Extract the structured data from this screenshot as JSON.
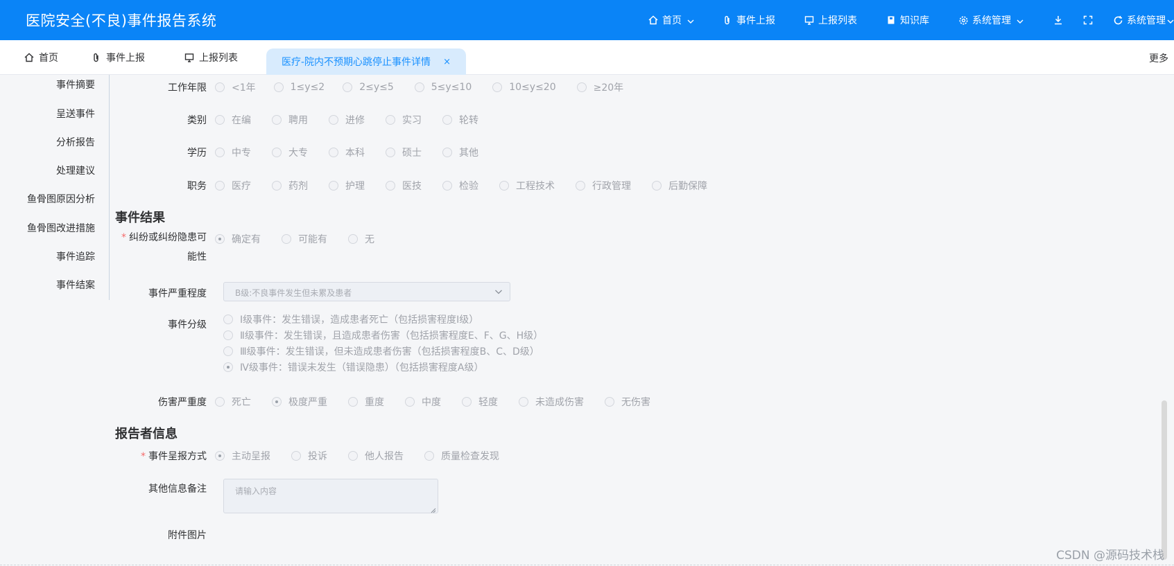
{
  "header": {
    "app_title": "医院安全(不良)事件报告系统",
    "nav": [
      {
        "label": "首页",
        "icon": "home-icon",
        "has_dropdown": true
      },
      {
        "label": "事件上报",
        "icon": "paperclip-icon",
        "has_dropdown": false
      },
      {
        "label": "上报列表",
        "icon": "monitor-icon",
        "has_dropdown": false
      },
      {
        "label": "知识库",
        "icon": "book-icon",
        "has_dropdown": false
      },
      {
        "label": "系统管理",
        "icon": "gear-icon",
        "has_dropdown": true
      },
      {
        "label": "",
        "icon": "download-icon",
        "has_dropdown": false
      },
      {
        "label": "",
        "icon": "fullscreen-icon",
        "has_dropdown": false
      },
      {
        "label": "系统管理",
        "icon": "refresh-icon",
        "has_dropdown": true
      }
    ]
  },
  "tabs": [
    {
      "label": "首页",
      "icon": "home-icon"
    },
    {
      "label": "事件上报",
      "icon": "paperclip-icon"
    },
    {
      "label": "上报列表",
      "icon": "monitor-icon"
    }
  ],
  "active_tab": {
    "label": "医疗-院内不预期心跳停止事件详情",
    "close": "×"
  },
  "more_label": "更多",
  "leftnav": [
    "事件摘要",
    "呈送事件",
    "分析报告",
    "处理建议",
    "鱼骨图原因分析",
    "鱼骨图改进措施",
    "事件追踪",
    "事件结案"
  ],
  "form": {
    "work_years": {
      "label": "工作年限",
      "options": [
        "<1年",
        "1≤y≤2",
        "2≤y≤5",
        "5≤y≤10",
        "10≤y≤20",
        "≥20年"
      ],
      "selected": -1
    },
    "category": {
      "label": "类别",
      "options": [
        "在编",
        "聘用",
        "进修",
        "实习",
        "轮转"
      ],
      "selected": -1
    },
    "education": {
      "label": "学历",
      "options": [
        "中专",
        "大专",
        "本科",
        "硕士",
        "其他"
      ],
      "selected": -1
    },
    "position": {
      "label": "职务",
      "options": [
        "医疗",
        "药剂",
        "护理",
        "医技",
        "检验",
        "工程技术",
        "行政管理",
        "后勤保障"
      ],
      "selected": -1
    },
    "result_section": "事件结果",
    "dispute": {
      "required": "*",
      "label_line1": "纠纷或纠纷隐患可",
      "label_line2": "能性",
      "options": [
        "确定有",
        "可能有",
        "无"
      ],
      "selected": 0
    },
    "severity": {
      "label": "事件严重程度",
      "value": "B级:不良事件发生但未累及患者"
    },
    "grade": {
      "label": "事件分级",
      "options": [
        "Ⅰ级事件：发生错误，造成患者死亡（包括损害程度Ⅰ级）",
        "Ⅱ级事件：发生错误，且造成患者伤害（包括损害程度E、F、G、H级）",
        "Ⅲ级事件：发生错误，但未造成患者伤害（包括损害程度B、C、D级）",
        "Ⅳ级事件：错误未发生（错误隐患）（包括损害程度A级）"
      ],
      "selected": 3
    },
    "harm": {
      "label": "伤害严重度",
      "options": [
        "死亡",
        "极度严重",
        "重度",
        "中度",
        "轻度",
        "未造成伤害",
        "无伤害"
      ],
      "selected": 1
    },
    "reporter_section": "报告者信息",
    "report_method": {
      "required": "*",
      "label": "事件呈报方式",
      "options": [
        "主动呈报",
        "投诉",
        "他人报告",
        "质量检查发现"
      ],
      "selected": 0
    },
    "other_info": {
      "label": "其他信息备注",
      "placeholder": "请输入内容"
    },
    "attachments": {
      "label": "附件图片"
    }
  },
  "watermark": "CSDN @源码技术栈",
  "colors": {
    "header_bg": "#0a84f7",
    "active_tab_bg": "#d8ebfd",
    "active_tab_text": "#1890ff",
    "required": "#f56c6c"
  }
}
